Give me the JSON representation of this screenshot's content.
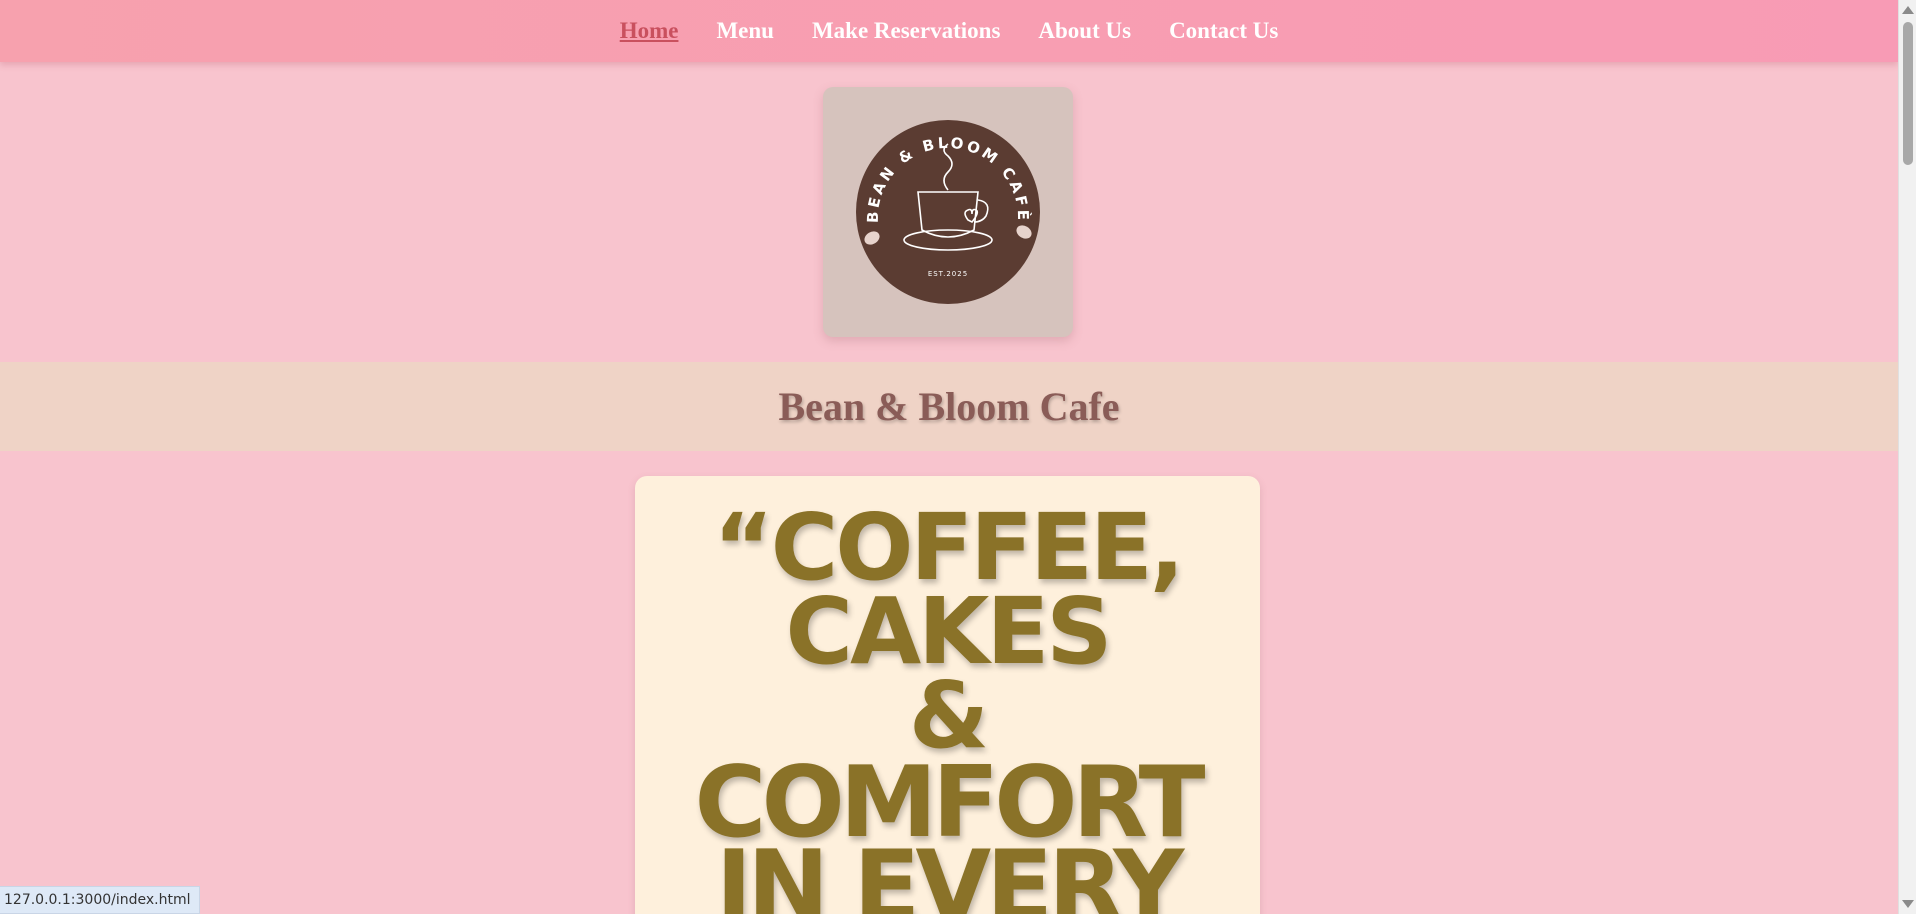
{
  "nav": {
    "items": [
      {
        "label": "Home",
        "active": true
      },
      {
        "label": "Menu"
      },
      {
        "label": "Make Reservations"
      },
      {
        "label": "About Us"
      },
      {
        "label": "Contact Us"
      }
    ]
  },
  "logo": {
    "circle_text": "BEAN & BLOOM CAFÈ",
    "est": "EST.2025",
    "icon": "coffee-cup-icon"
  },
  "title": "Bean & Bloom Cafe",
  "quote": {
    "lines": [
      "“COFFEE,",
      "CAKES",
      "&",
      "COMFORT",
      "IN EVERY"
    ]
  },
  "status_bar": "127.0.0.1:3000/index.html",
  "colors": {
    "background": "#f8c4ce",
    "nav": "#f89bb5",
    "active_link": "#c9505e",
    "title": "#8a5c57",
    "quote_text": "#8a7228",
    "logo_circle": "#5b3c32"
  }
}
